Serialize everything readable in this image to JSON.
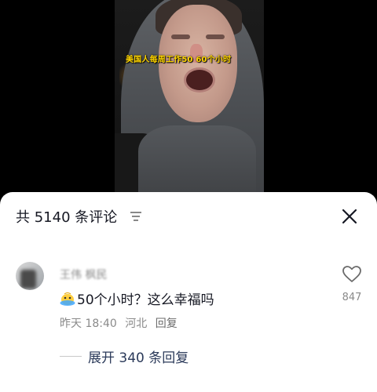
{
  "video": {
    "caption": "美国人每周工作50  60个小时"
  },
  "sheet": {
    "title": "共 5140 条评论",
    "sort_icon": "sort-lines-icon",
    "close_icon": "close-icon"
  },
  "comments": [
    {
      "username": "王伟 枫民",
      "emoji": "crying-face-emoji",
      "text": "50个小时？这么幸福吗",
      "time": "昨天 18:40",
      "location": "河北",
      "reply_label": "回复",
      "likes": "847",
      "expand_label": "展开 340 条回复"
    }
  ],
  "colors": {
    "caption": "#ffd500",
    "text_primary": "#161823",
    "text_secondary": "#8a8a8a",
    "expand_link": "#2b3a5a"
  }
}
